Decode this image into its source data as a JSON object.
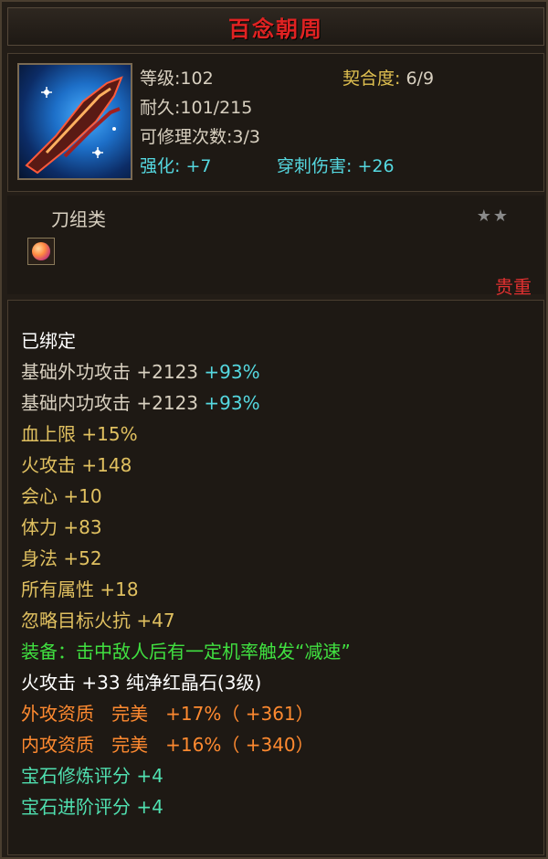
{
  "item": {
    "name": "百念朝周",
    "level_label": "等级:",
    "level_value": "102",
    "compat_label": "契合度:",
    "compat_value": "6/9",
    "durability_label": "耐久:",
    "durability_value": "101/215",
    "repair_label": "可修理次数:",
    "repair_value": "3/3",
    "enhance_label": "强化:",
    "enhance_value": "+7",
    "pierce_label": "穿刺伤害:",
    "pierce_value": "+26",
    "category": "刀组类",
    "stars": "★★",
    "rarity": "贵重",
    "icon": "blade-weapon-icon",
    "gem_icon": "gem-icon"
  },
  "attributes": {
    "bound": "已绑定",
    "ext_atk_label": "基础外功攻击",
    "ext_atk_value": "+2123",
    "ext_atk_pct": "+93%",
    "int_atk_label": "基础内功攻击",
    "int_atk_value": "+2123",
    "int_atk_pct": "+93%",
    "hp_cap": "血上限 +15%",
    "fire_atk": "火攻击 +148",
    "crit": "会心 +10",
    "stamina": "体力 +83",
    "agility": "身法 +52",
    "all_attr": "所有属性 +18",
    "ignore_fire": "忽略目标火抗 +47",
    "equip_effect": "装备：击中敌人后有一定机率触发“减速”",
    "gem_line": "火攻击 +33 纯净红晶石(3级)",
    "ext_quality_label": "外攻资质",
    "ext_quality_grade": "完美",
    "ext_quality_value": "+17%（ +361）",
    "int_quality_label": "内攻资质",
    "int_quality_grade": "完美",
    "int_quality_value": "+16%（ +340）",
    "gem_refine": "宝石修炼评分 +4",
    "gem_advance": "宝石进阶评分 +4"
  },
  "colors": {
    "title": "#e02222",
    "cyan": "#55d8e0",
    "gold": "#e0c060",
    "green": "#40e040",
    "orange": "#ff8a30",
    "rarity": "#e03030"
  }
}
